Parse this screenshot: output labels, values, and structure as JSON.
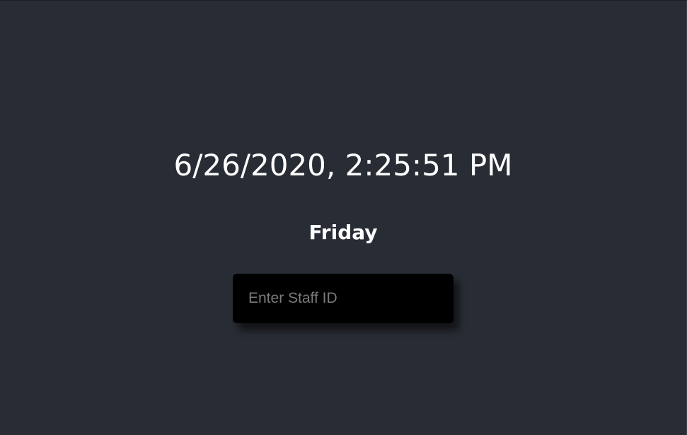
{
  "clock": {
    "datetime": "6/26/2020, 2:25:51 PM",
    "weekday": "Friday"
  },
  "staff_input": {
    "value": "",
    "placeholder": "Enter Staff ID"
  },
  "colors": {
    "background": "#282c34",
    "input_background": "#000000",
    "text": "#ffffff",
    "placeholder": "#7a7a7a"
  }
}
